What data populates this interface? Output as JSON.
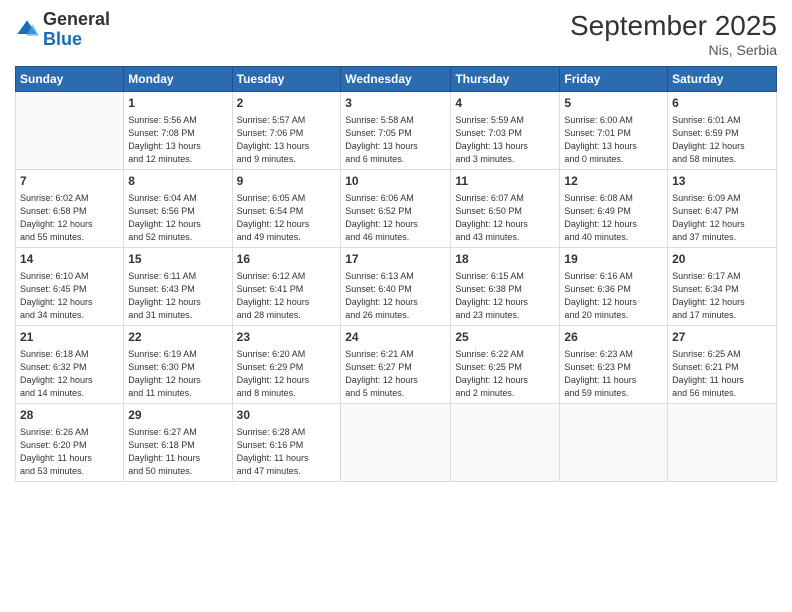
{
  "header": {
    "logo_general": "General",
    "logo_blue": "Blue",
    "month_year": "September 2025",
    "location": "Nis, Serbia"
  },
  "days_of_week": [
    "Sunday",
    "Monday",
    "Tuesday",
    "Wednesday",
    "Thursday",
    "Friday",
    "Saturday"
  ],
  "weeks": [
    [
      {
        "num": "",
        "info": ""
      },
      {
        "num": "1",
        "info": "Sunrise: 5:56 AM\nSunset: 7:08 PM\nDaylight: 13 hours\nand 12 minutes."
      },
      {
        "num": "2",
        "info": "Sunrise: 5:57 AM\nSunset: 7:06 PM\nDaylight: 13 hours\nand 9 minutes."
      },
      {
        "num": "3",
        "info": "Sunrise: 5:58 AM\nSunset: 7:05 PM\nDaylight: 13 hours\nand 6 minutes."
      },
      {
        "num": "4",
        "info": "Sunrise: 5:59 AM\nSunset: 7:03 PM\nDaylight: 13 hours\nand 3 minutes."
      },
      {
        "num": "5",
        "info": "Sunrise: 6:00 AM\nSunset: 7:01 PM\nDaylight: 13 hours\nand 0 minutes."
      },
      {
        "num": "6",
        "info": "Sunrise: 6:01 AM\nSunset: 6:59 PM\nDaylight: 12 hours\nand 58 minutes."
      }
    ],
    [
      {
        "num": "7",
        "info": "Sunrise: 6:02 AM\nSunset: 6:58 PM\nDaylight: 12 hours\nand 55 minutes."
      },
      {
        "num": "8",
        "info": "Sunrise: 6:04 AM\nSunset: 6:56 PM\nDaylight: 12 hours\nand 52 minutes."
      },
      {
        "num": "9",
        "info": "Sunrise: 6:05 AM\nSunset: 6:54 PM\nDaylight: 12 hours\nand 49 minutes."
      },
      {
        "num": "10",
        "info": "Sunrise: 6:06 AM\nSunset: 6:52 PM\nDaylight: 12 hours\nand 46 minutes."
      },
      {
        "num": "11",
        "info": "Sunrise: 6:07 AM\nSunset: 6:50 PM\nDaylight: 12 hours\nand 43 minutes."
      },
      {
        "num": "12",
        "info": "Sunrise: 6:08 AM\nSunset: 6:49 PM\nDaylight: 12 hours\nand 40 minutes."
      },
      {
        "num": "13",
        "info": "Sunrise: 6:09 AM\nSunset: 6:47 PM\nDaylight: 12 hours\nand 37 minutes."
      }
    ],
    [
      {
        "num": "14",
        "info": "Sunrise: 6:10 AM\nSunset: 6:45 PM\nDaylight: 12 hours\nand 34 minutes."
      },
      {
        "num": "15",
        "info": "Sunrise: 6:11 AM\nSunset: 6:43 PM\nDaylight: 12 hours\nand 31 minutes."
      },
      {
        "num": "16",
        "info": "Sunrise: 6:12 AM\nSunset: 6:41 PM\nDaylight: 12 hours\nand 28 minutes."
      },
      {
        "num": "17",
        "info": "Sunrise: 6:13 AM\nSunset: 6:40 PM\nDaylight: 12 hours\nand 26 minutes."
      },
      {
        "num": "18",
        "info": "Sunrise: 6:15 AM\nSunset: 6:38 PM\nDaylight: 12 hours\nand 23 minutes."
      },
      {
        "num": "19",
        "info": "Sunrise: 6:16 AM\nSunset: 6:36 PM\nDaylight: 12 hours\nand 20 minutes."
      },
      {
        "num": "20",
        "info": "Sunrise: 6:17 AM\nSunset: 6:34 PM\nDaylight: 12 hours\nand 17 minutes."
      }
    ],
    [
      {
        "num": "21",
        "info": "Sunrise: 6:18 AM\nSunset: 6:32 PM\nDaylight: 12 hours\nand 14 minutes."
      },
      {
        "num": "22",
        "info": "Sunrise: 6:19 AM\nSunset: 6:30 PM\nDaylight: 12 hours\nand 11 minutes."
      },
      {
        "num": "23",
        "info": "Sunrise: 6:20 AM\nSunset: 6:29 PM\nDaylight: 12 hours\nand 8 minutes."
      },
      {
        "num": "24",
        "info": "Sunrise: 6:21 AM\nSunset: 6:27 PM\nDaylight: 12 hours\nand 5 minutes."
      },
      {
        "num": "25",
        "info": "Sunrise: 6:22 AM\nSunset: 6:25 PM\nDaylight: 12 hours\nand 2 minutes."
      },
      {
        "num": "26",
        "info": "Sunrise: 6:23 AM\nSunset: 6:23 PM\nDaylight: 11 hours\nand 59 minutes."
      },
      {
        "num": "27",
        "info": "Sunrise: 6:25 AM\nSunset: 6:21 PM\nDaylight: 11 hours\nand 56 minutes."
      }
    ],
    [
      {
        "num": "28",
        "info": "Sunrise: 6:26 AM\nSunset: 6:20 PM\nDaylight: 11 hours\nand 53 minutes."
      },
      {
        "num": "29",
        "info": "Sunrise: 6:27 AM\nSunset: 6:18 PM\nDaylight: 11 hours\nand 50 minutes."
      },
      {
        "num": "30",
        "info": "Sunrise: 6:28 AM\nSunset: 6:16 PM\nDaylight: 11 hours\nand 47 minutes."
      },
      {
        "num": "",
        "info": ""
      },
      {
        "num": "",
        "info": ""
      },
      {
        "num": "",
        "info": ""
      },
      {
        "num": "",
        "info": ""
      }
    ]
  ]
}
